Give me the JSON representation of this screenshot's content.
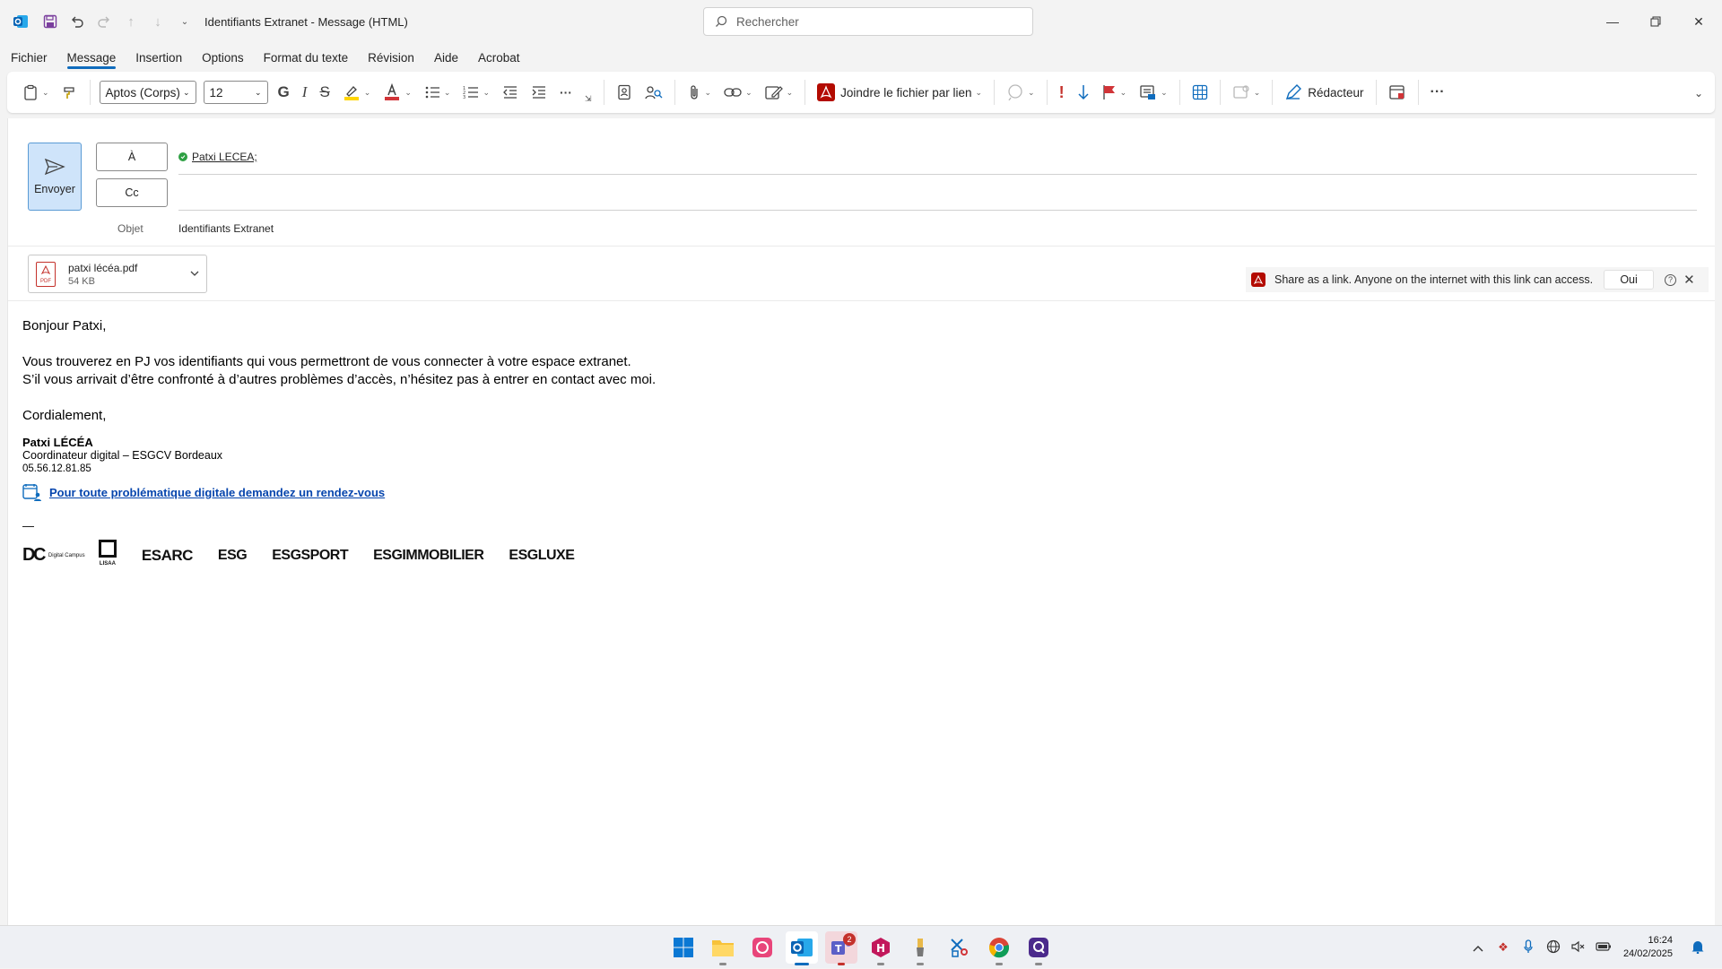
{
  "window": {
    "title": "Identifiants Extranet  -  Message (HTML)",
    "search_placeholder": "Rechercher"
  },
  "menu": {
    "tabs": [
      "Fichier",
      "Message",
      "Insertion",
      "Options",
      "Format du texte",
      "Révision",
      "Aide",
      "Acrobat"
    ],
    "active": "Message"
  },
  "ribbon": {
    "font_name": "Aptos (Corps)",
    "font_size": "12",
    "bold_glyph": "G",
    "italic_glyph": "I",
    "strike_glyph": "S",
    "attach_link_label": "Joindre le fichier par lien",
    "redacteur_label": "Rédacteur",
    "more_label": "···"
  },
  "compose": {
    "send_label": "Envoyer",
    "to_label": "À",
    "cc_label": "Cc",
    "to_recipient": "Patxi LECEA;",
    "subject_label": "Objet",
    "subject_value": "Identifiants Extranet"
  },
  "attachment": {
    "name": "patxi lécéa.pdf",
    "size": "54 KB",
    "icon_text": "PDF"
  },
  "share_bar": {
    "message": "Share as a link. Anyone on the internet with this link can access.",
    "yes_label": "Oui"
  },
  "body": {
    "greeting": "Bonjour Patxi,",
    "line1": "Vous trouverez en PJ vos identifiants qui vous permettront de vous connecter à votre espace extranet.",
    "line2": "S’il vous arrivait d’être confronté à d’autres problèmes d’accès, n’hésitez pas à entrer en contact avec moi.",
    "closing": "Cordialement,",
    "sig_name": "Patxi LÉCÉA",
    "sig_title": "Coordinateur digital – ESGCV Bordeaux",
    "sig_phone": "05.56.12.81.85",
    "sig_link": "Pour toute problématique digitale demandez un rendez-vous",
    "dash": "—",
    "logos": [
      "Digital Campus",
      "LISAA",
      "ESARC",
      "ESG",
      "ESGSPORT",
      "ESGIMMOBILIER",
      "ESGLUXE"
    ]
  },
  "taskbar": {
    "teams_badge": "2",
    "time": "16:24",
    "date": "24/02/2025"
  }
}
